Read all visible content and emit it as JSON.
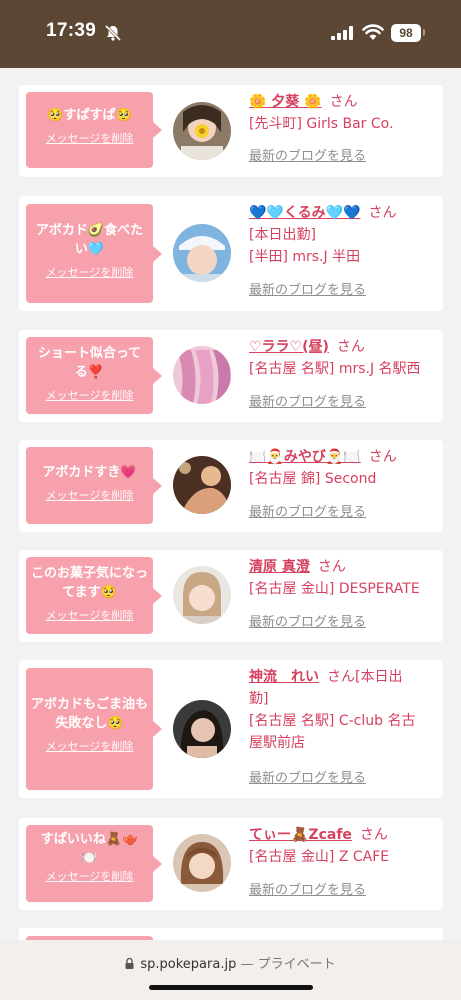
{
  "status_bar": {
    "time": "17:39",
    "battery": "98"
  },
  "browser": {
    "url": "sp.pokepara.jp",
    "private_label": "— プライベート"
  },
  "delete_label": "メッセージを削除",
  "blog_label": "最新のブログを見る",
  "san_label": "さん",
  "cards": [
    {
      "message": "🥺すぱすぱ🥺",
      "name": "🌼 夕葵 🌼",
      "shop_lines": [
        "[先斗町] Girls Bar Co."
      ]
    },
    {
      "message": "アボカド🥑食べたい🩵",
      "name": "💙🩵くるみ🩵💙",
      "shop_lines": [
        "[本日出勤]",
        "[半田] mrs.J 半田"
      ]
    },
    {
      "message": "ショート似合ってる❣️",
      "name": "♡ララ♡(昼)",
      "shop_lines": [
        "[名古屋 名駅] mrs.J 名駅西"
      ]
    },
    {
      "message": "アボカドすき💗",
      "name": "🍽️🎅みやび🎅🍽️",
      "shop_lines": [
        "[名古屋 錦] Second"
      ]
    },
    {
      "message": "このお菓子気になってます🥺",
      "name": "清原 真澄",
      "shop_lines": [
        "[名古屋 金山] DESPERATE"
      ]
    },
    {
      "message": "アボカドもごま油も失敗なし🥺",
      "name": "神流　れい",
      "name_suffix": "[本日出",
      "shop_lines": [
        "勤]",
        "[名古屋 名駅] C-club 名古",
        "屋駅前店"
      ]
    },
    {
      "message": "すぱいいね🧸🫖\n🍽️",
      "name": "てぃー🧸Zcafe",
      "shop_lines": [
        "[名古屋 金山] Z CAFE"
      ]
    }
  ]
}
